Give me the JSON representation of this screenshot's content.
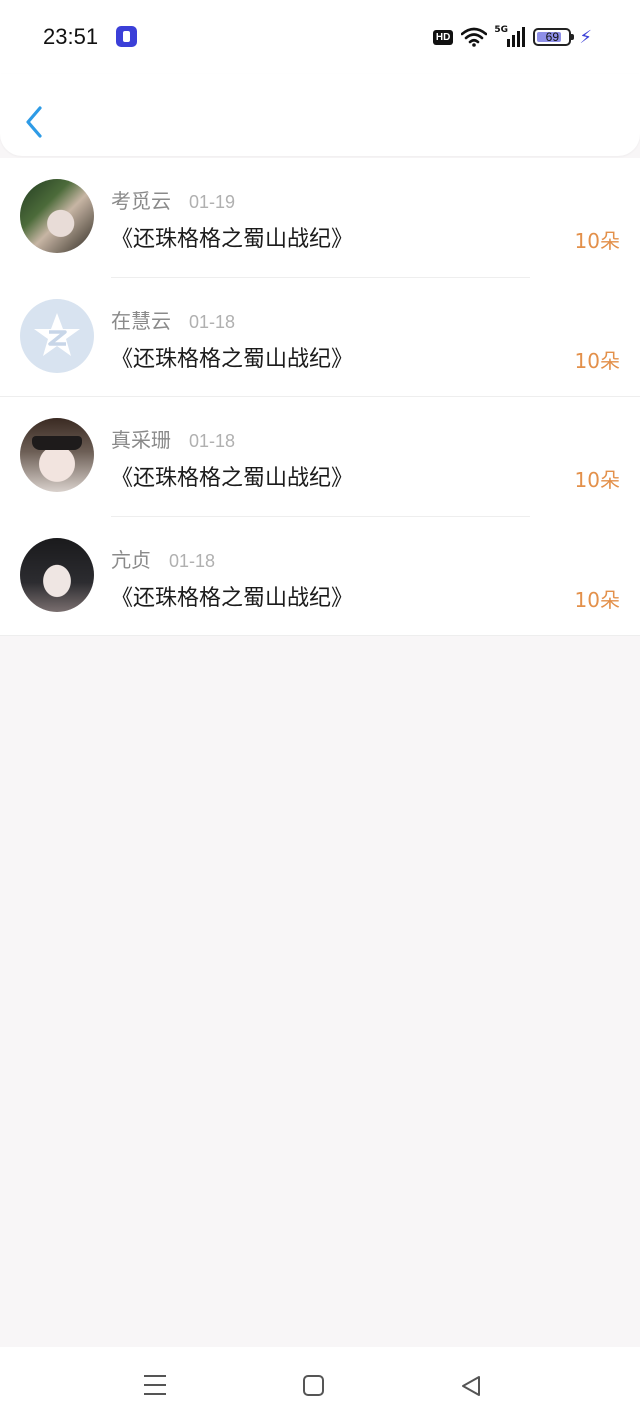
{
  "status_bar": {
    "time": "23:51",
    "hd_label": "HD",
    "network_label": "5G",
    "battery_percent": "69",
    "icons": [
      "app-badge-icon",
      "hd-icon",
      "wifi-icon",
      "signal-5g-icon",
      "battery-icon",
      "charging-icon"
    ]
  },
  "header": {
    "back_icon": "chevron-left-icon",
    "accent_color": "#2e9be6"
  },
  "records": [
    {
      "name": "考觅云",
      "date": "01-19",
      "title": "《还珠格格之蜀山战纪》",
      "amount": "10朵"
    },
    {
      "name": "在慧云",
      "date": "01-18",
      "title": "《还珠格格之蜀山战纪》",
      "amount": "10朵"
    },
    {
      "name": "真采珊",
      "date": "01-18",
      "title": "《还珠格格之蜀山战纪》",
      "amount": "10朵"
    },
    {
      "name": "亢贞",
      "date": "01-18",
      "title": "《还珠格格之蜀山战纪》",
      "amount": "10朵"
    }
  ],
  "colors": {
    "amount": "#e3904a",
    "name": "#8a8a8a",
    "date": "#b0b0b0",
    "background": "#f8f6f7"
  },
  "navbar": {
    "icons": [
      "menu-icon",
      "home-icon",
      "back-triangle-icon"
    ]
  }
}
